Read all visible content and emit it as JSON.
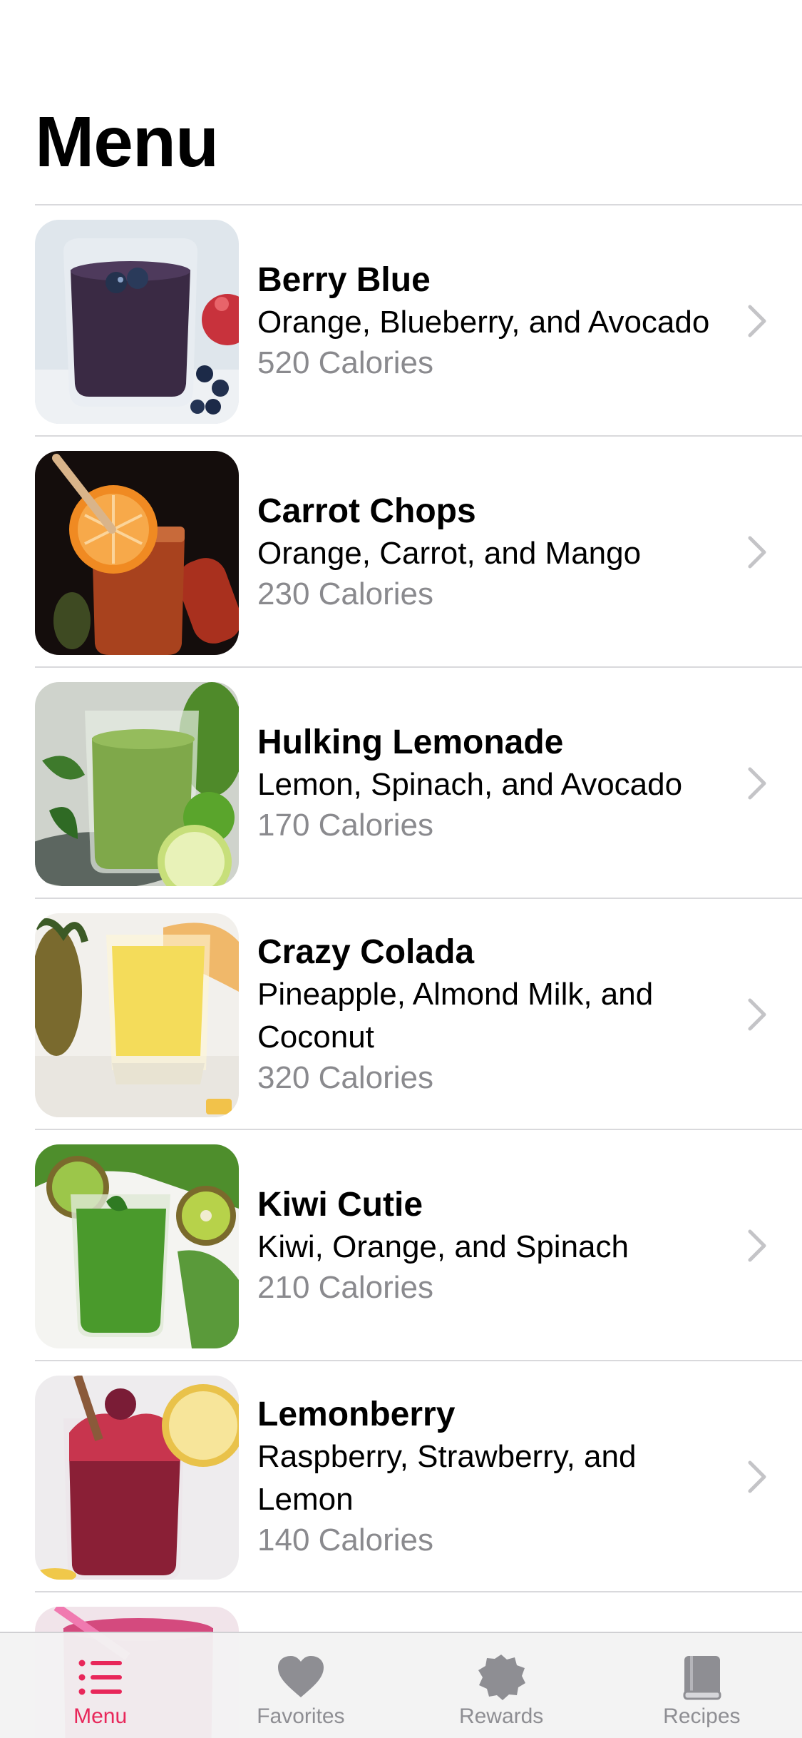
{
  "page": {
    "title": "Menu"
  },
  "colors": {
    "accent": "#e8275a",
    "secondary_text": "#8a8a8e",
    "tab_inactive": "#8e8e93",
    "chevron": "#c4c4c7"
  },
  "menu": {
    "items": [
      {
        "name": "Berry Blue",
        "ingredients": "Orange, Blueberry, and Avocado",
        "calories": "520 Calories",
        "image": "berry-blue-smoothie"
      },
      {
        "name": "Carrot Chops",
        "ingredients": "Orange, Carrot, and Mango",
        "calories": "230 Calories",
        "image": "carrot-chops-smoothie"
      },
      {
        "name": "Hulking Lemonade",
        "ingredients": "Lemon, Spinach, and Avocado",
        "calories": "170 Calories",
        "image": "hulking-lemonade-smoothie"
      },
      {
        "name": "Crazy Colada",
        "ingredients": "Pineapple, Almond Milk, and Coconut",
        "calories": "320 Calories",
        "image": "crazy-colada-smoothie"
      },
      {
        "name": "Kiwi Cutie",
        "ingredients": "Kiwi, Orange, and Spinach",
        "calories": "210 Calories",
        "image": "kiwi-cutie-smoothie"
      },
      {
        "name": "Lemonberry",
        "ingredients": "Raspberry, Strawberry, and Lemon",
        "calories": "140 Calories",
        "image": "lemonberry-smoothie"
      }
    ]
  },
  "tabbar": {
    "tabs": [
      {
        "label": "Menu",
        "icon": "list-icon",
        "active": true
      },
      {
        "label": "Favorites",
        "icon": "heart-icon",
        "active": false
      },
      {
        "label": "Rewards",
        "icon": "seal-icon",
        "active": false
      },
      {
        "label": "Recipes",
        "icon": "book-icon",
        "active": false
      }
    ]
  }
}
